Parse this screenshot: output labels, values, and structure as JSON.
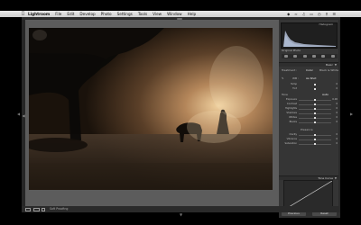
{
  "menubar": {
    "app_name": "Lightroom",
    "items": [
      "File",
      "Edit",
      "Develop",
      "Photo",
      "Settings",
      "Tools",
      "View",
      "Window",
      "Help"
    ]
  },
  "panel": {
    "histogram_title": "Histogram",
    "original_photo_label": "Original Photo",
    "basic_section": "Basic",
    "treatment_label": "Treatment :",
    "color_option": "Color",
    "bw_option": "Black & White",
    "wb_label": "WB :",
    "wb_value": "As Shot",
    "tone_label": "Tone",
    "auto_label": "Auto",
    "presence_label": "Presence",
    "tone_curve_section": "Tone Curve",
    "sliders": [
      {
        "label": "Temp",
        "value": "0"
      },
      {
        "label": "Tint",
        "value": "0"
      },
      {
        "label": "Exposure",
        "value": "0.00"
      },
      {
        "label": "Contrast",
        "value": "0"
      },
      {
        "label": "Highlights",
        "value": "0"
      },
      {
        "label": "Shadows",
        "value": "0"
      },
      {
        "label": "Whites",
        "value": "0"
      },
      {
        "label": "Blacks",
        "value": "0"
      },
      {
        "label": "Clarity",
        "value": "0"
      },
      {
        "label": "Vibrance",
        "value": "0"
      },
      {
        "label": "Saturation",
        "value": "0"
      }
    ]
  },
  "buttons": {
    "previous": "Previous",
    "reset": "Reset"
  },
  "filmstrip": {
    "soft_proofing": "Soft Proofing"
  },
  "colors": {
    "panel_bg": "#353535",
    "photo_frame": "#5c5c5c"
  }
}
